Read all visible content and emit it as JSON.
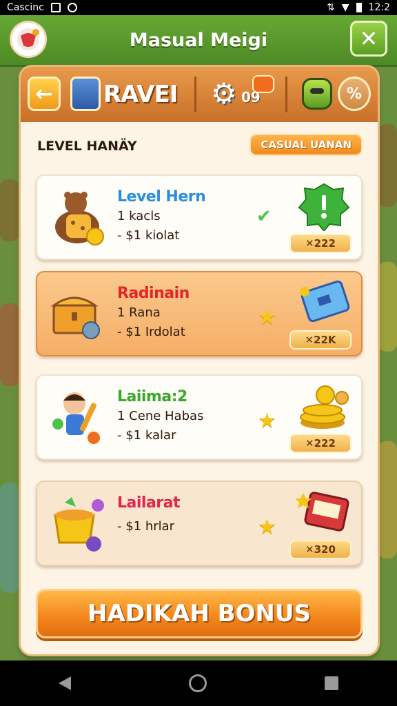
{
  "statusbar": {
    "carrier": "Cascinc",
    "time": "12:2"
  },
  "appbar": {
    "title": "Masual Meigi",
    "close_label": "✕"
  },
  "toolbar": {
    "back_label": "←",
    "title": "RAVEI",
    "gear_label": "09",
    "tool_label": "%"
  },
  "section": {
    "title": "LEVEL HANÄY",
    "casual_button": "CASUAL UANAN"
  },
  "cards": [
    {
      "title": "Level Hern",
      "title_color": "#2a8ee0",
      "line1": "1 kacls",
      "line2": "- $1 kiolat",
      "price": "✕222",
      "style": "white",
      "marker": "check"
    },
    {
      "title": "Radinain",
      "title_color": "#e0262a",
      "line1": "1 Rana",
      "line2": "- $1 Irdolat",
      "price": "✕22K",
      "style": "orange",
      "marker": "star"
    },
    {
      "title": "Laiima:2",
      "title_color": "#3aa82a",
      "line1": "1 Cene Habas",
      "line2": "- $1 kalar",
      "price": "✕222",
      "style": "white",
      "marker": "star"
    },
    {
      "title": "Lailarat",
      "title_color": "#e0264a",
      "line1": "",
      "line2": "- $1 hrlar",
      "price": "✕320",
      "style": "beige",
      "marker": "star"
    }
  ],
  "bonus_button": "HADIKAH BONUS",
  "colors": {
    "appbar_green": "#5a9a2c",
    "toolbar_orange": "#d97e32",
    "panel_bg": "#fdf4e6",
    "bonus_orange": "#f2851c"
  }
}
